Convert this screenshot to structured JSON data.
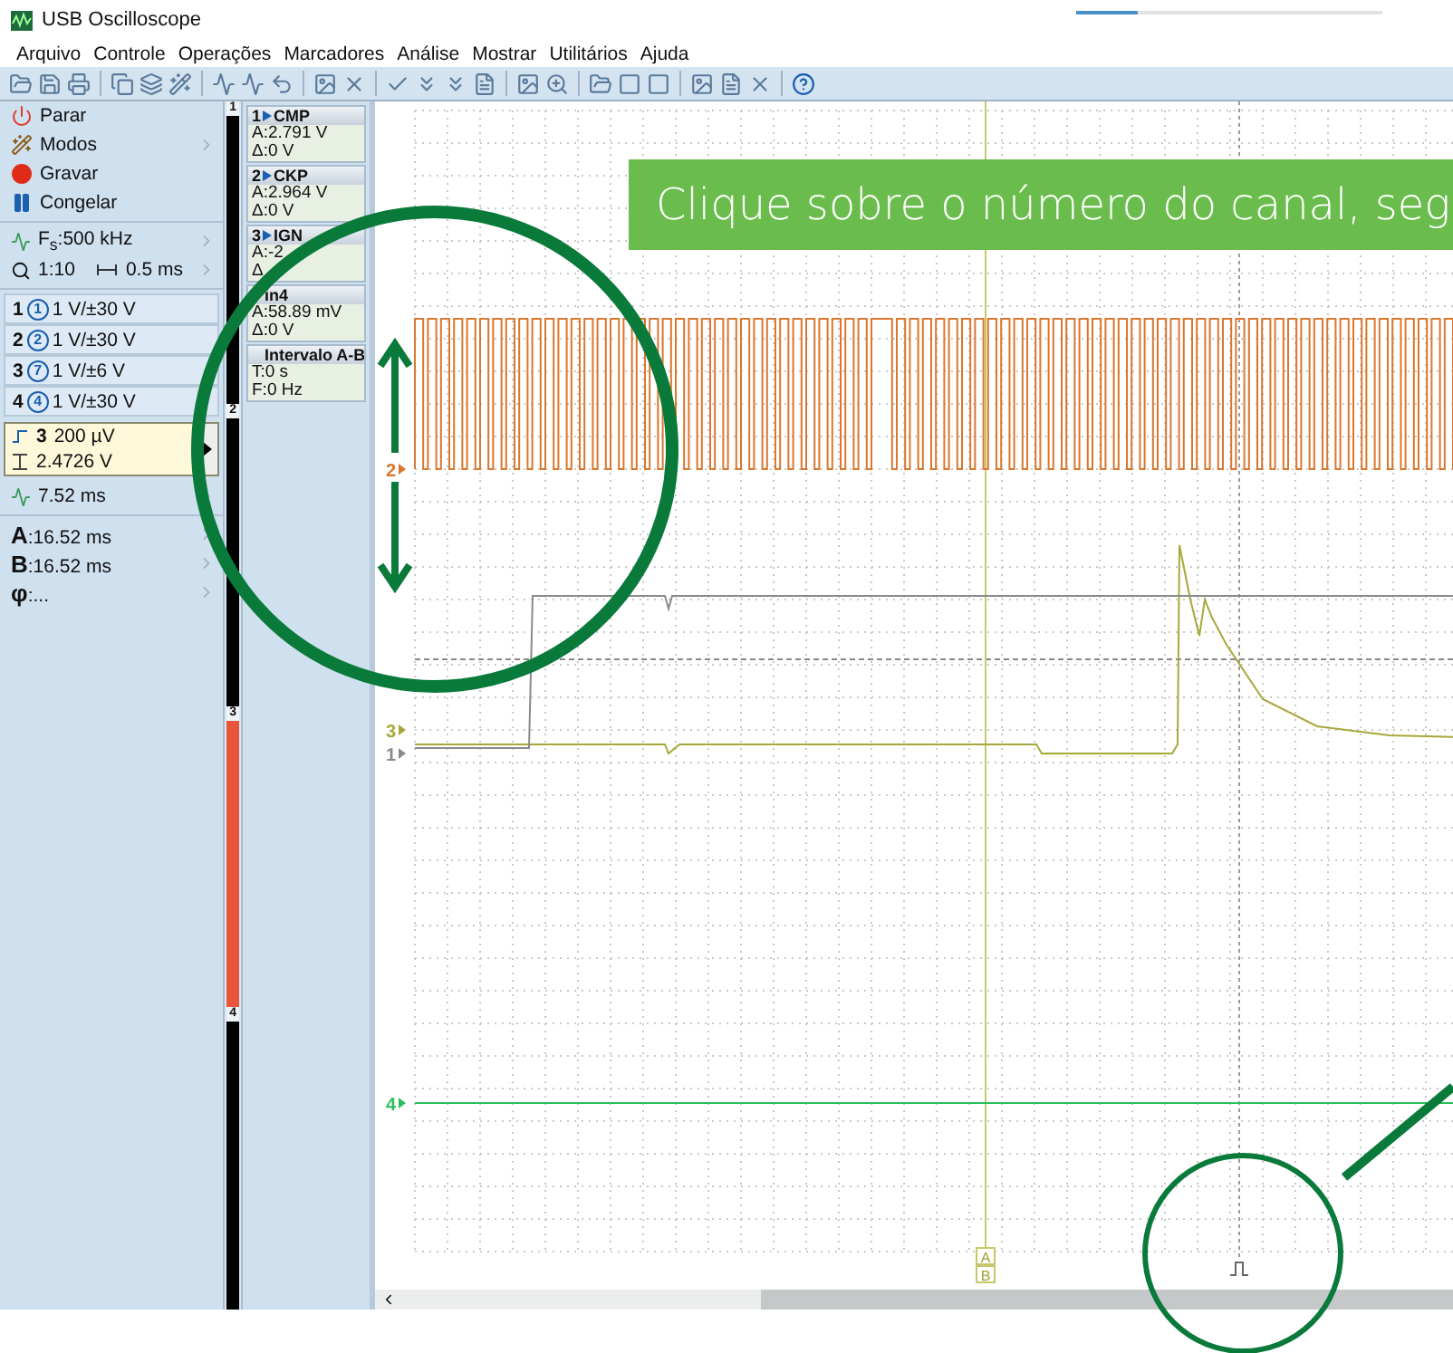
{
  "window": {
    "title": "USB Oscilloscope"
  },
  "progress": {
    "level": 0.2
  },
  "menu": [
    "Arquivo",
    "Controle",
    "Operações",
    "Marcadores",
    "Análise",
    "Mostrar",
    "Utilitários",
    "Ajuda"
  ],
  "controls": [
    {
      "kind": "stop",
      "label": "Parar",
      "arrow": false
    },
    {
      "kind": "modes",
      "label": "Modos",
      "arrow": true
    },
    {
      "kind": "record",
      "label": "Gravar",
      "arrow": false
    },
    {
      "kind": "freeze",
      "label": "Congelar",
      "arrow": false
    }
  ],
  "sampling": {
    "rate": "F$_{s}$:500 kHz",
    "zoom": "1:10",
    "timebase": "0.5 ms"
  },
  "channels": [
    {
      "number": "1",
      "probe": "1",
      "range": "1 V/±30 V"
    },
    {
      "number": "2",
      "probe": "2",
      "range": "1 V/±30 V"
    },
    {
      "number": "3",
      "probe": "7",
      "range": "1 V/±6 V"
    },
    {
      "number": "4",
      "probe": "4",
      "range": "1 V/±30 V"
    }
  ],
  "trigger": {
    "channel": "3",
    "level": "200 µV",
    "value": "2.4726 V"
  },
  "delay": "7.52 ms",
  "markers": [
    {
      "label": "A",
      "value": ":16.52 ms"
    },
    {
      "label": "B",
      "value": ":16.52 ms"
    },
    {
      "label": "φ",
      "value": ":..."
    }
  ],
  "ruler": [
    {
      "label": "1",
      "color": "#000000"
    },
    {
      "label": "2",
      "color": "#000000"
    },
    {
      "label": "3",
      "color": "#e8553a"
    },
    {
      "label": "4",
      "color": "#000000"
    }
  ],
  "readouts": [
    {
      "number": "1",
      "name": "CMP",
      "lines": [
        "A:2.791 V",
        "Δ:0 V"
      ]
    },
    {
      "number": "2",
      "name": "CKP",
      "lines": [
        "A:2.964 V",
        "Δ:0 V"
      ]
    },
    {
      "number": "3",
      "name": "IGN",
      "lines": [
        "A:-2",
        "Δ"
      ]
    },
    {
      "name": "in4",
      "lines": [
        "A:58.89 mV",
        "Δ:0 V"
      ]
    },
    {
      "name": "Intervalo A-B",
      "lines": [
        "T:0 s",
        "F:0 Hz"
      ]
    }
  ],
  "plot": {
    "traces": [
      {
        "label": "2",
        "color": "#d9772e"
      },
      {
        "label": "3",
        "color": "#a8a83a"
      },
      {
        "label": "1",
        "color": "#8a8a8a"
      },
      {
        "label": "4",
        "color": "#2bbf5a"
      }
    ],
    "cursors": [
      "A",
      "B"
    ]
  },
  "annotation": {
    "text": "Clique sobre o número do canal, seg"
  }
}
